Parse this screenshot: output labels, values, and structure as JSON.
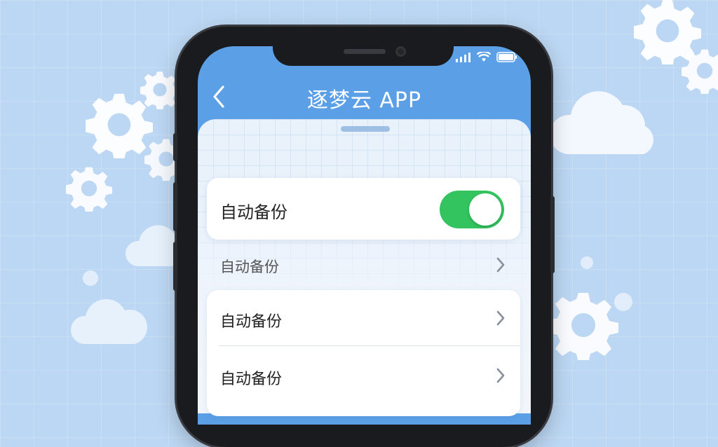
{
  "app": {
    "title": "逐梦云 APP"
  },
  "settings": {
    "toggle_row": {
      "label": "自动备份",
      "enabled": true
    },
    "plain_row": {
      "label": "自动备份"
    },
    "list_rows": [
      {
        "label": "自动备份"
      },
      {
        "label": "自动备份"
      }
    ]
  },
  "colors": {
    "background": "#bcd7f3",
    "header": "#5b9fe6",
    "toggle_on": "#34c45f"
  },
  "icons": {
    "back": "chevron-left-icon",
    "signal": "signal-icon",
    "wifi": "wifi-icon",
    "battery": "battery-icon",
    "row_chevron": "chevron-right-icon"
  }
}
